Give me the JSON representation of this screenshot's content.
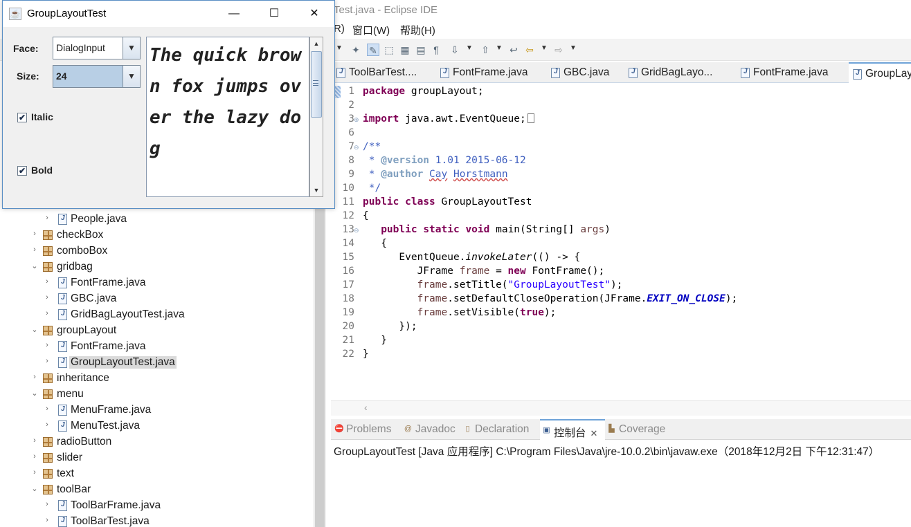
{
  "eclipse": {
    "title": "Test.java - Eclipse IDE",
    "menu": [
      "R)",
      "窗口(W)",
      "帮助(H)"
    ]
  },
  "editor": {
    "tabs": [
      "ToolBarTest....",
      "FontFrame.java",
      "GBC.java",
      "GridBagLayo...",
      "FontFrame.java",
      "GroupLay"
    ],
    "line_numbers": [
      "1",
      "2",
      "3",
      "6",
      "7",
      "8",
      "9",
      "10",
      "11",
      "12",
      "13",
      "14",
      "15",
      "16",
      "17",
      "18",
      "19",
      "20",
      "21",
      "22"
    ],
    "lines": {
      "l1_kw": "package",
      "l1_rest": " groupLayout;",
      "l3_kw": "import",
      "l3_rest": " java.awt.EventQueue;",
      "l7": "/**",
      "l8_tag": "@version",
      "l8_rest": " 1.01 2015-06-12",
      "l9_tag": "@author",
      "l9_name1": "Cay",
      "l9_name2": "Horstmann",
      "l10": " */",
      "l11_kw1": "public",
      "l11_kw2": "class",
      "l11_rest": " GroupLayoutTest",
      "l12": "{",
      "l13_kw1": "public",
      "l13_kw2": "static",
      "l13_kw3": "void",
      "l13_rest": " main(String[] ",
      "l13_args": "args",
      "l13_end": ")",
      "l14": "   {",
      "l15_a": "      EventQueue.",
      "l15_b": "invokeLater",
      "l15_c": "(() -> {",
      "l16_a": "         JFrame ",
      "l16_b": "frame",
      "l16_c": " = ",
      "l16_kw": "new",
      "l16_d": " FontFrame();",
      "l17_a": "         ",
      "l17_b": "frame",
      "l17_c": ".setTitle(",
      "l17_str": "\"GroupLayoutTest\"",
      "l17_d": ");",
      "l18_a": "         ",
      "l18_b": "frame",
      "l18_c": ".setDefaultCloseOperation(JFrame.",
      "l18_sf": "EXIT_ON_CLOSE",
      "l18_d": ");",
      "l19_a": "         ",
      "l19_b": "frame",
      "l19_c": ".setVisible(",
      "l19_kw": "true",
      "l19_d": ");",
      "l20": "      });",
      "l21": "   }",
      "l22": "}"
    }
  },
  "views": {
    "tabs": [
      "Problems",
      "Javadoc",
      "Declaration",
      "控制台",
      "Coverage"
    ],
    "console_line": "GroupLayoutTest [Java 应用程序] C:\\Program Files\\Java\\jre-10.0.2\\bin\\javaw.exe（2018年12月2日 下午12:31:47）"
  },
  "explorer": {
    "items": [
      {
        "label": "People.java"
      },
      {
        "label": "checkBox"
      },
      {
        "label": "comboBox"
      },
      {
        "label": "gridbag"
      },
      {
        "label": "FontFrame.java"
      },
      {
        "label": "GBC.java"
      },
      {
        "label": "GridBagLayoutTest.java"
      },
      {
        "label": "groupLayout"
      },
      {
        "label": "FontFrame.java"
      },
      {
        "label": "GroupLayoutTest.java"
      },
      {
        "label": "inheritance"
      },
      {
        "label": "menu"
      },
      {
        "label": "MenuFrame.java"
      },
      {
        "label": "MenuTest.java"
      },
      {
        "label": "radioButton"
      },
      {
        "label": "slider"
      },
      {
        "label": "text"
      },
      {
        "label": "toolBar"
      },
      {
        "label": "ToolBarFrame.java"
      },
      {
        "label": "ToolBarTest.java"
      }
    ]
  },
  "dialog": {
    "title": "GroupLayoutTest",
    "face_label": "Face:",
    "face_value": "DialogInput",
    "size_label": "Size:",
    "size_value": "24",
    "italic_label": "Italic",
    "bold_label": "Bold",
    "check_mark": "✔",
    "sample_text": "The quick brown fox jumps over the lazy dog",
    "minimize": "—",
    "maximize": "☐",
    "close": "✕"
  },
  "colors": {
    "dialog_border": "#5a8fc4",
    "combo_selected": "#b8cfe5",
    "keyword": "#7f0055",
    "string": "#2a00ff",
    "javadoc": "#3f5fbf"
  }
}
